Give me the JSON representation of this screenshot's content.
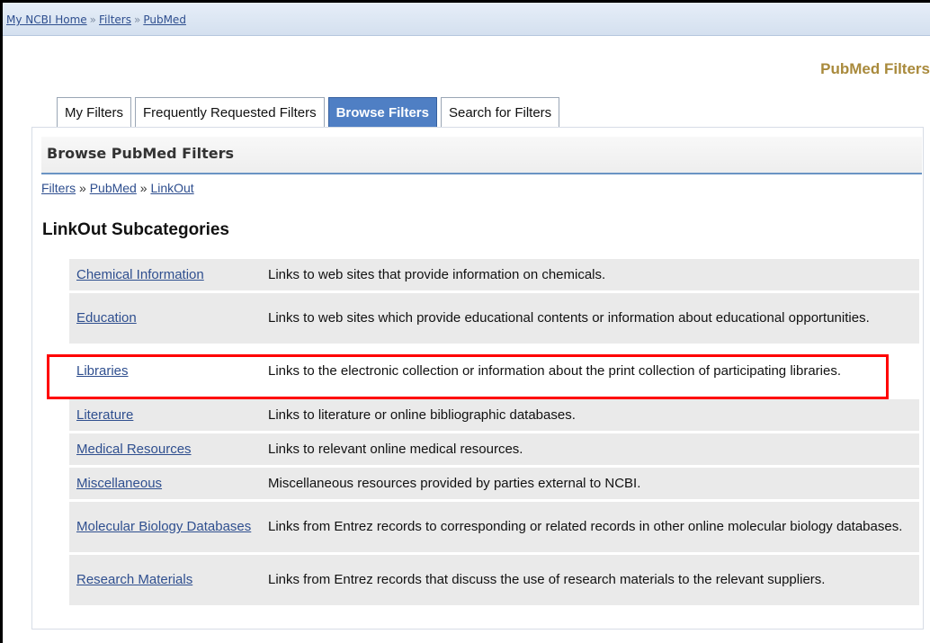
{
  "breadcrumb": {
    "home": "My NCBI Home",
    "separator": "»",
    "filters": "Filters",
    "current": "PubMed"
  },
  "page_title": "PubMed Filters",
  "tabs": [
    {
      "label": "My Filters",
      "active": false
    },
    {
      "label": "Frequently Requested Filters",
      "active": false
    },
    {
      "label": "Browse Filters",
      "active": true
    },
    {
      "label": "Search for Filters",
      "active": false
    }
  ],
  "panel": {
    "header": "Browse PubMed Filters",
    "path": {
      "filters": "Filters",
      "separator": "»",
      "pubmed": "PubMed",
      "linkout": "LinkOut"
    },
    "section_title": "LinkOut Subcategories"
  },
  "subcategories": [
    {
      "name": "Chemical Information",
      "description": "Links to web sites that provide information on chemicals."
    },
    {
      "name": "Education",
      "description": "Links to web sites which provide educational contents or information about educational opportunities."
    },
    {
      "name": "Libraries",
      "description": "Links to the electronic collection or information about the print collection of participating libraries."
    },
    {
      "name": "Literature",
      "description": "Links to literature or online bibliographic databases."
    },
    {
      "name": "Medical Resources",
      "description": "Links to relevant online medical resources."
    },
    {
      "name": "Miscellaneous",
      "description": "Miscellaneous resources provided by parties external to NCBI."
    },
    {
      "name": "Molecular Biology Databases",
      "description": "Links from Entrez records to corresponding or related records in other online molecular biology databases."
    },
    {
      "name": "Research Materials",
      "description": "Links from Entrez records that discuss the use of research materials to the relevant suppliers."
    }
  ],
  "highlighted_row": "Libraries",
  "colors": {
    "accent_tab": "#4f7fc4",
    "title_gold": "#a98a3c",
    "link": "#2f4f8f",
    "row_bg": "#eaeaea",
    "highlight": "#ff0000"
  }
}
